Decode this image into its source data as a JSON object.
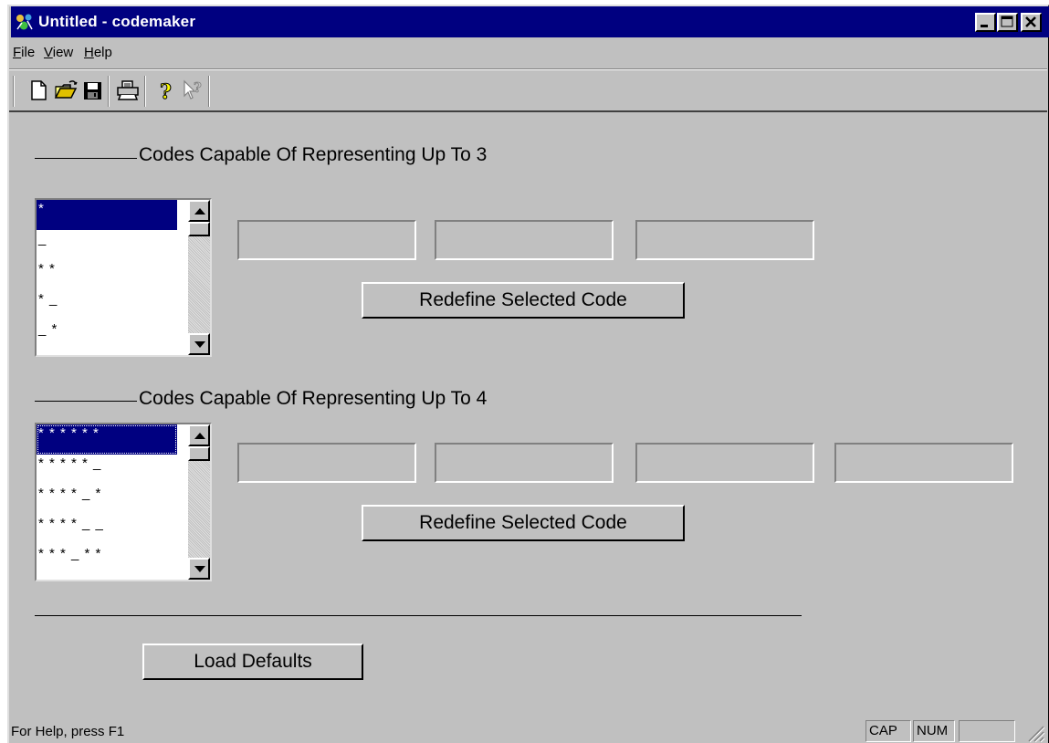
{
  "window": {
    "title": "Untitled - codemaker",
    "colors": {
      "titlebar": "#000080",
      "face": "#c0c0c0",
      "selection": "#000080"
    }
  },
  "titlebar_buttons": [
    {
      "name": "minimize-button",
      "icon": "minimize-icon"
    },
    {
      "name": "maximize-button",
      "icon": "maximize-icon"
    },
    {
      "name": "close-button",
      "icon": "close-icon"
    }
  ],
  "menu": {
    "file": {
      "pre": "",
      "hot": "F",
      "post": "ile"
    },
    "view": {
      "pre": "",
      "hot": "V",
      "post": "iew"
    },
    "help": {
      "pre": "",
      "hot": "H",
      "post": "elp"
    }
  },
  "toolbar": {
    "items": [
      "new-file-icon",
      "open-folder-icon",
      "save-disk-icon",
      "print-icon",
      "about-help-icon",
      "context-help-icon"
    ]
  },
  "group3": {
    "label": "Codes Capable Of Representing Up To 3",
    "list": [
      "*",
      "_",
      "* *",
      "* _",
      "_ *"
    ],
    "selected_index": 0,
    "fields": [
      "",
      "",
      ""
    ],
    "button_label": "Redefine Selected Code"
  },
  "group4": {
    "label": "Codes Capable Of Representing Up To 4",
    "list": [
      "* * * * * *",
      "* * * * * _",
      "* * * * _ *",
      "* * * * _ _",
      "* * * _ * *"
    ],
    "selected_index": 0,
    "fields": [
      "",
      "",
      "",
      ""
    ],
    "button_label": "Redefine Selected Code"
  },
  "load_defaults_label": "Load Defaults",
  "status": {
    "text": "For Help, press F1",
    "cap": "CAP",
    "num": "NUM",
    "scrl": ""
  }
}
